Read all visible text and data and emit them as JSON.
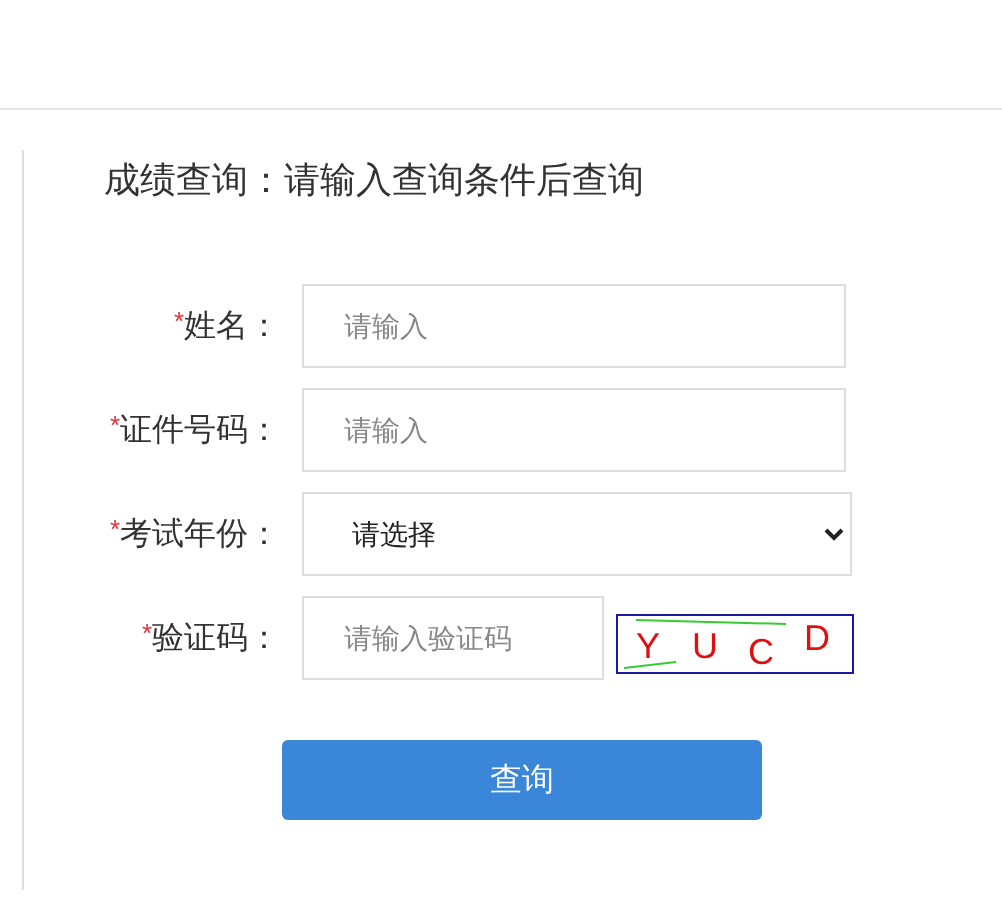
{
  "title": "成绩查询：请输入查询条件后查询",
  "fields": [
    {
      "kind": "input",
      "required_mark": "*",
      "label": "姓名：",
      "placeholder": "请输入"
    },
    {
      "kind": "input",
      "required_mark": "*",
      "label": "证件号码：",
      "placeholder": "请输入"
    },
    {
      "kind": "select",
      "required_mark": "*",
      "label": "考试年份：",
      "value": "请选择"
    },
    {
      "kind": "captcha",
      "required_mark": "*",
      "label": "验证码：",
      "placeholder": "请输入验证码",
      "captcha": [
        "Y",
        "U",
        "C",
        "D"
      ]
    }
  ],
  "submit": "查询"
}
